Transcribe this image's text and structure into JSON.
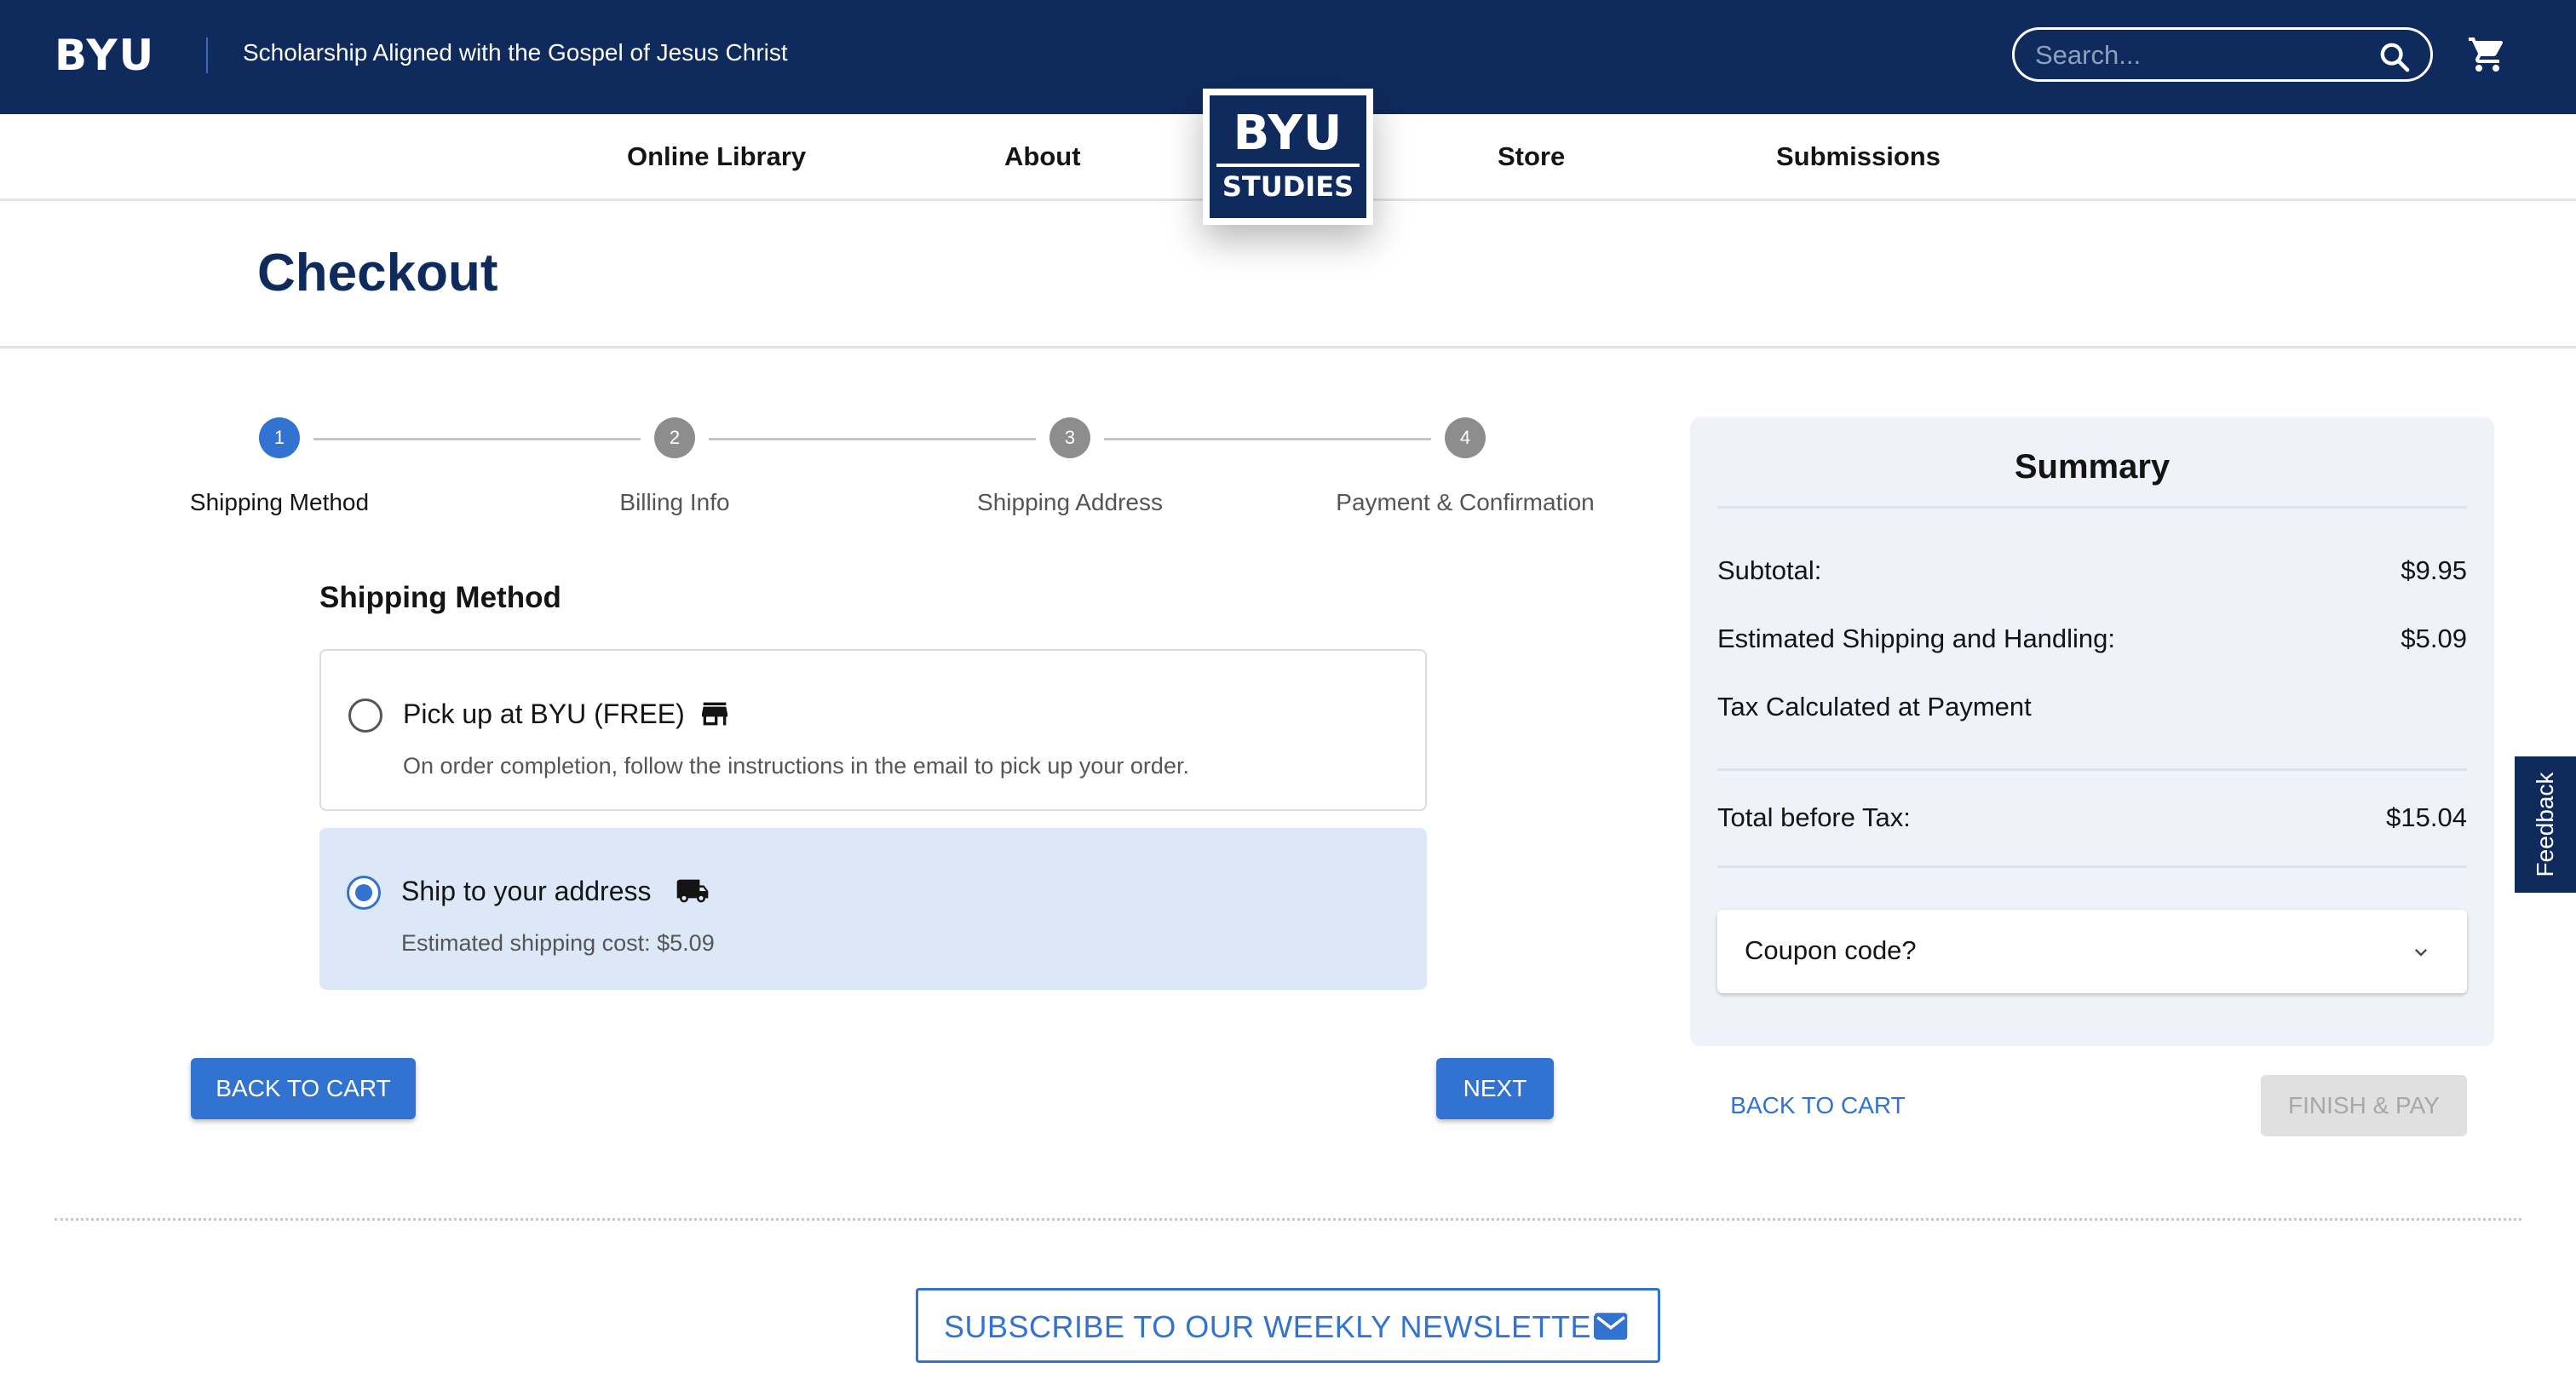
{
  "header": {
    "logo": "BYU",
    "tagline": "Scholarship Aligned with the Gospel of Jesus Christ",
    "search_placeholder": "Search...",
    "search_icon": "search-icon",
    "cart_icon": "cart-icon"
  },
  "nav": {
    "items": [
      {
        "label": "Online Library"
      },
      {
        "label": "About"
      },
      {
        "label": "Store"
      },
      {
        "label": "Submissions"
      }
    ],
    "logo": {
      "top": "BYU",
      "bottom": "STUDIES"
    }
  },
  "page": {
    "title": "Checkout"
  },
  "stepper": {
    "active_step": 1,
    "steps": [
      {
        "number": "1",
        "label": "Shipping Method"
      },
      {
        "number": "2",
        "label": "Billing Info"
      },
      {
        "number": "3",
        "label": "Shipping Address"
      },
      {
        "number": "4",
        "label": "Payment & Confirmation"
      }
    ]
  },
  "shipping": {
    "heading": "Shipping Method",
    "options": [
      {
        "title": "Pick up at BYU (FREE)",
        "description": "On order completion, follow the instructions in the email to pick up your order.",
        "icon": "store-icon",
        "selected": false
      },
      {
        "title": "Ship to your address",
        "description": "Estimated shipping cost: $5.09",
        "icon": "truck-icon",
        "selected": true
      }
    ],
    "back_label": "BACK TO CART",
    "next_label": "NEXT"
  },
  "summary": {
    "title": "Summary",
    "subtotal_label": "Subtotal:",
    "subtotal_value": "$9.95",
    "shipping_label": "Estimated Shipping and Handling:",
    "shipping_value": "$5.09",
    "tax_note": "Tax Calculated at Payment",
    "total_label": "Total before Tax:",
    "total_value": "$15.04",
    "coupon_label": "Coupon code?",
    "back_label": "BACK TO CART",
    "finish_label": "FINISH & PAY"
  },
  "feedback": {
    "label": "Feedback"
  },
  "footer": {
    "newsletter_label": "SUBSCRIBE TO OUR WEEKLY NEWSLETTER",
    "newsletter_icon": "mail-icon"
  },
  "colors": {
    "navy": "#0f2a5c",
    "accent_blue": "#3272d0",
    "selected_bg": "#dce8f8",
    "summary_bg": "#eff3f9"
  }
}
